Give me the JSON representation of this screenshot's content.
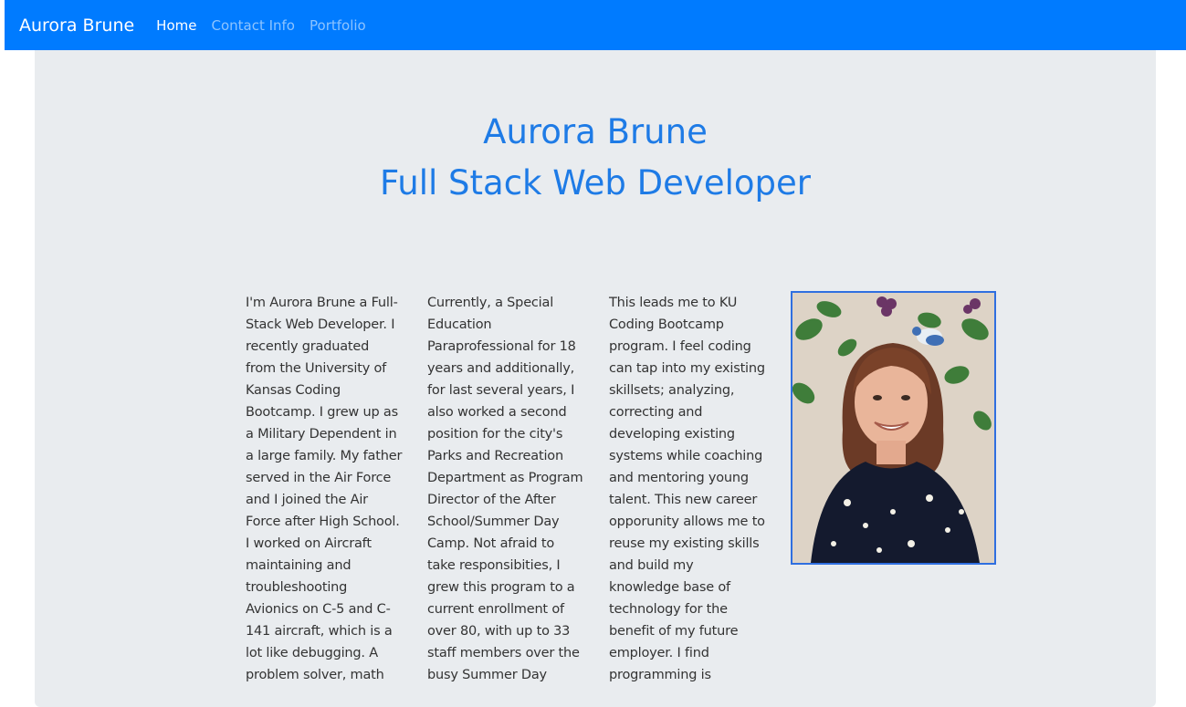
{
  "navbar": {
    "brand": "Aurora Brune",
    "links": [
      {
        "label": "Home",
        "active": true
      },
      {
        "label": "Contact Info",
        "active": false
      },
      {
        "label": "Portfolio",
        "active": false
      }
    ]
  },
  "hero": {
    "name": "Aurora Brune",
    "title": "Full Stack Web Developer"
  },
  "bio": {
    "paragraphs": [
      "I'm Aurora Brune a Full-Stack Web Developer. I recently graduated from the University of Kansas Coding Bootcamp. I grew up as a Military Dependent in a large family. My father served in the Air Force and I joined the Air Force after High School. I worked on Aircraft maintaining and troubleshooting Avionics on C-5 and C-141 aircraft, which is a lot like debugging. A problem solver, math",
      "Currently, a Special Education Paraprofessional for 18 years and additionally, for last several years, I also worked a second position for the city's Parks and Recreation Department as Program Director of the After School/Summer Day Camp. Not afraid to take responsibities, I grew this program to a current enrollment of over 80, with up to 33 staff members over the busy Summer Day",
      "This leads me to KU Coding Bootcamp program. I feel coding can tap into my existing skillsets; analyzing, correcting and developing existing systems while coaching and mentoring young talent. This new career opporunity allows me to reuse my existing skills and build my knowledge base of technology for the benefit of my future employer. I find programming is"
    ]
  },
  "photo": {
    "icon": "profile-photo",
    "border_color": "#2f6fe0"
  },
  "colors": {
    "navbar": "#007bff",
    "heading": "#1e7be6",
    "jumbotron": "#e9ecef"
  }
}
